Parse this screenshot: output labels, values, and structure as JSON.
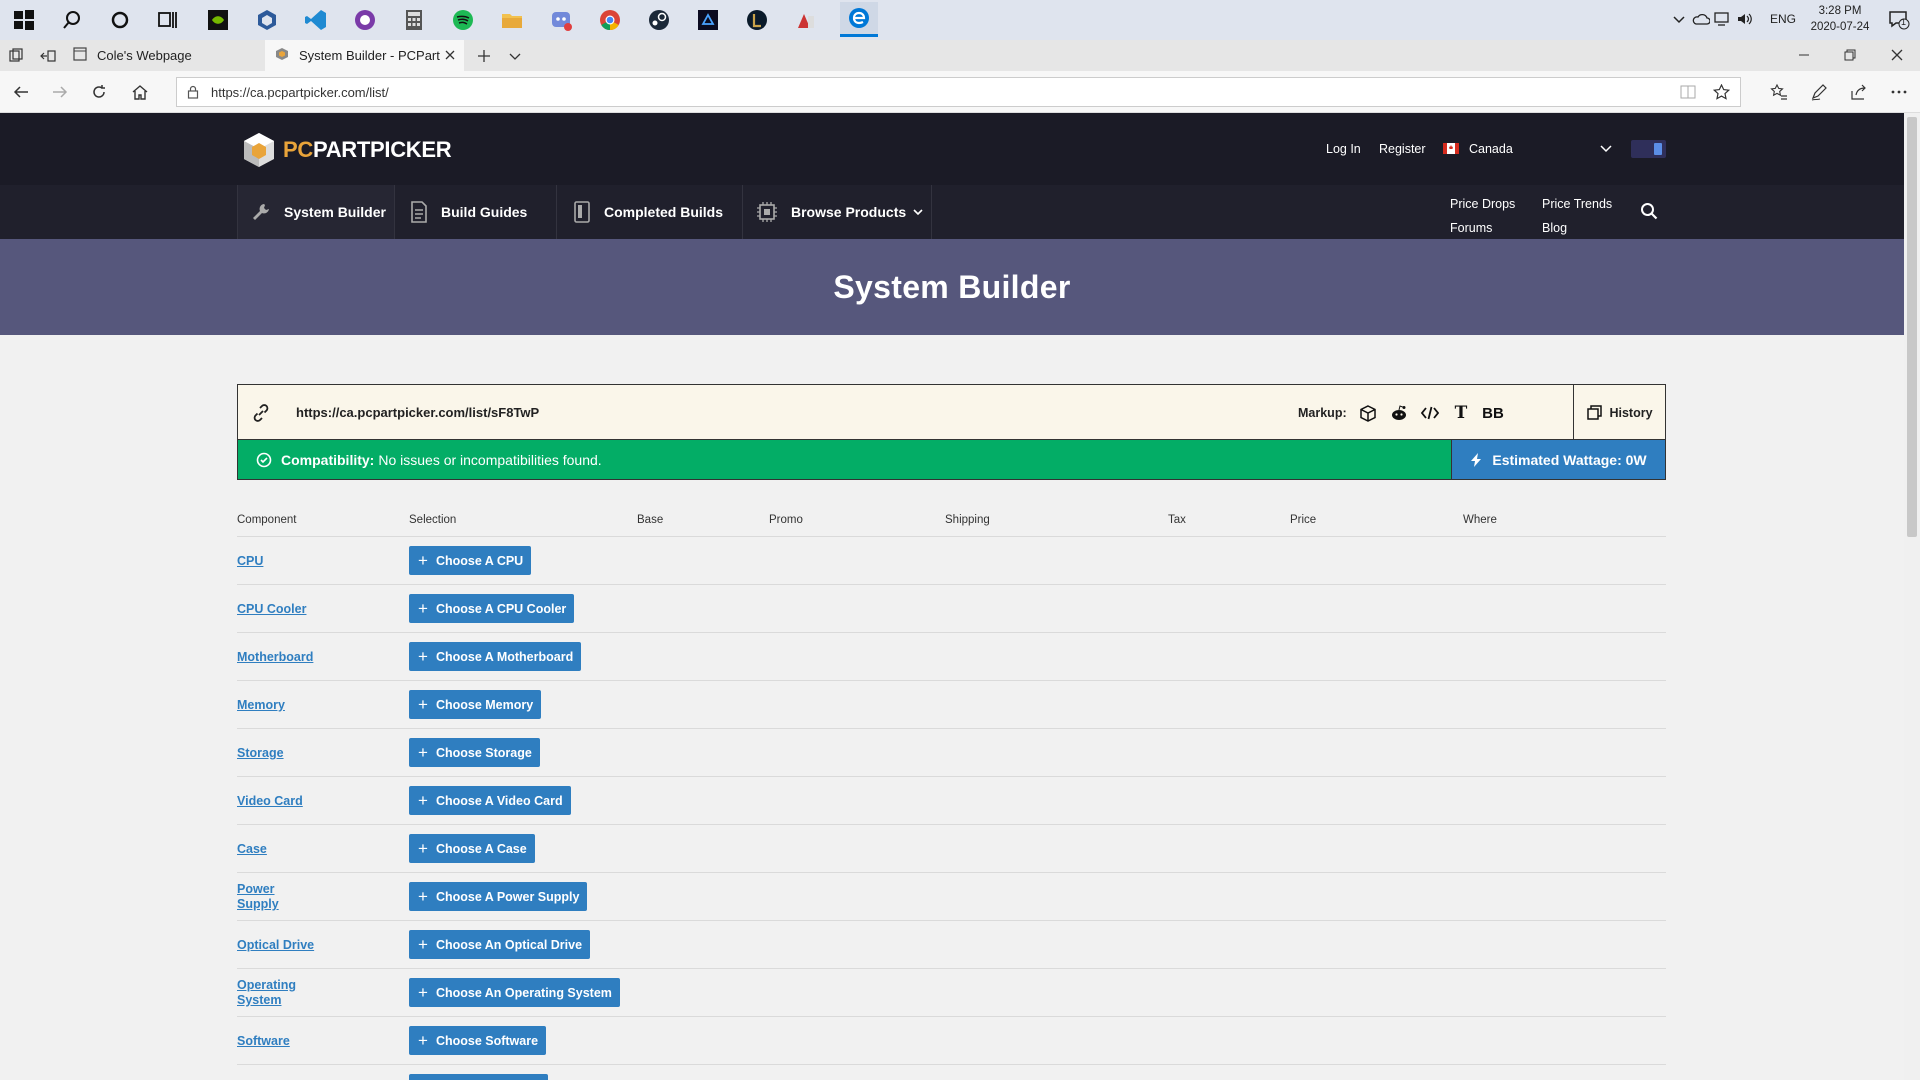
{
  "os": {
    "clock_time": "3:28 PM",
    "clock_date": "2020-07-24",
    "language": "ENG",
    "notification_count": "1"
  },
  "browser": {
    "tabs": [
      {
        "label": "Cole's Webpage"
      },
      {
        "label": "System Builder - PCPart"
      }
    ],
    "url": "https://ca.pcpartpicker.com/list/"
  },
  "site": {
    "logo_text_accent": "PC",
    "logo_text_main": "PARTPICKER",
    "header_links": {
      "login": "Log In",
      "register": "Register",
      "region": "Canada"
    },
    "main_nav": [
      {
        "label": "System Builder"
      },
      {
        "label": "Build Guides"
      },
      {
        "label": "Completed Builds"
      },
      {
        "label": "Browse Products"
      }
    ],
    "secondary_nav": {
      "price_drops": "Price Drops",
      "price_trends": "Price Trends",
      "forums": "Forums",
      "blog": "Blog"
    },
    "page_title": "System Builder",
    "permalink": "https://ca.pcpartpicker.com/list/sF8TwP",
    "markup_label": "Markup:",
    "markup_bb": "BB",
    "markup_text": "T",
    "history_label": "History",
    "compatibility_label": "Compatibility:",
    "compatibility_text": "No issues or incompatibilities found.",
    "wattage_text": "Estimated Wattage: 0W",
    "columns": [
      "Component",
      "Selection",
      "Base",
      "Promo",
      "Shipping",
      "Tax",
      "Price",
      "Where"
    ],
    "components": [
      {
        "name": "CPU",
        "button": "Choose A CPU"
      },
      {
        "name": "CPU Cooler",
        "button": "Choose A CPU Cooler"
      },
      {
        "name": "Motherboard",
        "button": "Choose A Motherboard"
      },
      {
        "name": "Memory",
        "button": "Choose Memory"
      },
      {
        "name": "Storage",
        "button": "Choose Storage"
      },
      {
        "name": "Video Card",
        "button": "Choose A Video Card"
      },
      {
        "name": "Case",
        "button": "Choose A Case"
      },
      {
        "name": "Power Supply",
        "button": "Choose A Power Supply"
      },
      {
        "name": "Optical Drive",
        "button": "Choose An Optical Drive"
      },
      {
        "name": "Operating System",
        "button": "Choose An Operating System"
      },
      {
        "name": "Software",
        "button": "Choose Software"
      }
    ]
  },
  "colors": {
    "accent_blue": "#2f7ec0",
    "compat_green": "#03ad66",
    "banner_purple": "#56577c",
    "header_dark": "#1b1b26"
  }
}
